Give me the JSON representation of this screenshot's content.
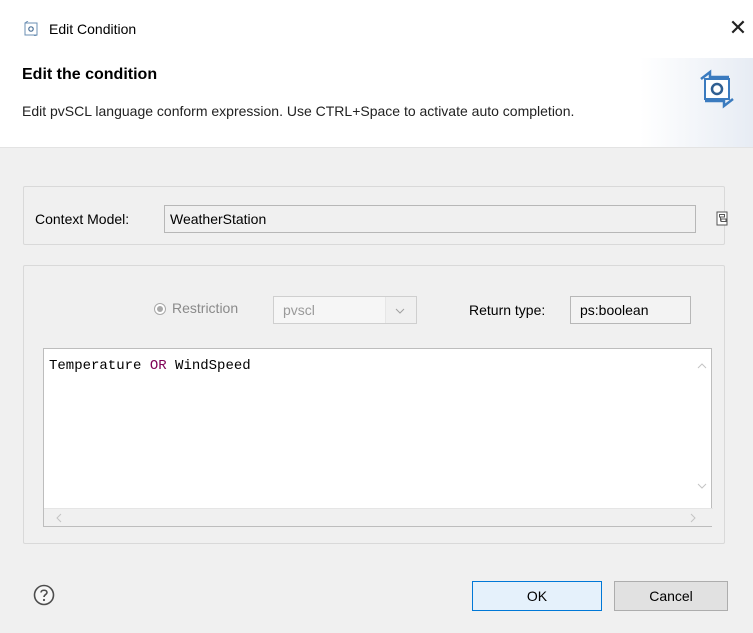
{
  "window": {
    "title": "Edit Condition",
    "close_label": "✕"
  },
  "header": {
    "title": "Edit the condition",
    "message": "Edit pvSCL language conform expression. Use CTRL+Space to activate auto completion."
  },
  "context": {
    "label": "Context Model:",
    "value": "WeatherStation"
  },
  "restriction": {
    "label": "Restriction",
    "combo_value": "pvscl"
  },
  "return_type": {
    "label": "Return type:",
    "value": "ps:boolean"
  },
  "editor": {
    "tokens": [
      {
        "text": "Temperature "
      },
      {
        "text": "OR"
      },
      {
        "text": " WindSpeed"
      }
    ]
  },
  "buttons": {
    "ok": "OK",
    "cancel": "Cancel"
  },
  "colors": {
    "keyword": "#7f0055",
    "accent": "#0078d7"
  }
}
